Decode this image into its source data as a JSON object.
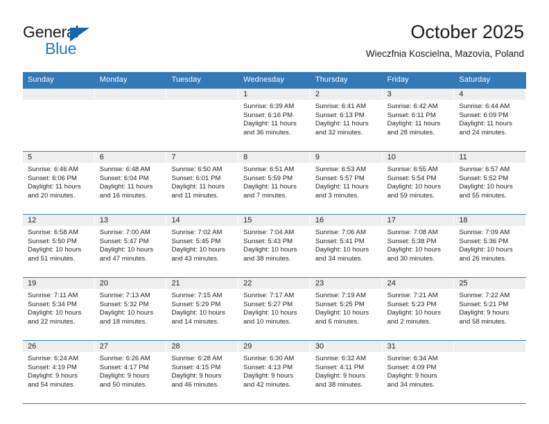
{
  "brand": {
    "name_part1": "General",
    "name_part2": "Blue",
    "logo_icon": "triangle-logo-icon",
    "blue": "#1f7ac4"
  },
  "header": {
    "title": "October 2025",
    "subtitle": "Wieczfnia Koscielna, Mazovia, Poland"
  },
  "calendar": {
    "header_color": "#3479b5",
    "weekdays": [
      "Sunday",
      "Monday",
      "Tuesday",
      "Wednesday",
      "Thursday",
      "Friday",
      "Saturday"
    ],
    "weeks": [
      [
        {
          "day": "",
          "sunrise": "",
          "sunset": "",
          "daylight1": "",
          "daylight2": ""
        },
        {
          "day": "",
          "sunrise": "",
          "sunset": "",
          "daylight1": "",
          "daylight2": ""
        },
        {
          "day": "",
          "sunrise": "",
          "sunset": "",
          "daylight1": "",
          "daylight2": ""
        },
        {
          "day": "1",
          "sunrise": "Sunrise: 6:39 AM",
          "sunset": "Sunset: 6:16 PM",
          "daylight1": "Daylight: 11 hours",
          "daylight2": "and 36 minutes."
        },
        {
          "day": "2",
          "sunrise": "Sunrise: 6:41 AM",
          "sunset": "Sunset: 6:13 PM",
          "daylight1": "Daylight: 11 hours",
          "daylight2": "and 32 minutes."
        },
        {
          "day": "3",
          "sunrise": "Sunrise: 6:42 AM",
          "sunset": "Sunset: 6:11 PM",
          "daylight1": "Daylight: 11 hours",
          "daylight2": "and 28 minutes."
        },
        {
          "day": "4",
          "sunrise": "Sunrise: 6:44 AM",
          "sunset": "Sunset: 6:09 PM",
          "daylight1": "Daylight: 11 hours",
          "daylight2": "and 24 minutes."
        }
      ],
      [
        {
          "day": "5",
          "sunrise": "Sunrise: 6:46 AM",
          "sunset": "Sunset: 6:06 PM",
          "daylight1": "Daylight: 11 hours",
          "daylight2": "and 20 minutes."
        },
        {
          "day": "6",
          "sunrise": "Sunrise: 6:48 AM",
          "sunset": "Sunset: 6:04 PM",
          "daylight1": "Daylight: 11 hours",
          "daylight2": "and 16 minutes."
        },
        {
          "day": "7",
          "sunrise": "Sunrise: 6:50 AM",
          "sunset": "Sunset: 6:01 PM",
          "daylight1": "Daylight: 11 hours",
          "daylight2": "and 11 minutes."
        },
        {
          "day": "8",
          "sunrise": "Sunrise: 6:51 AM",
          "sunset": "Sunset: 5:59 PM",
          "daylight1": "Daylight: 11 hours",
          "daylight2": "and 7 minutes."
        },
        {
          "day": "9",
          "sunrise": "Sunrise: 6:53 AM",
          "sunset": "Sunset: 5:57 PM",
          "daylight1": "Daylight: 11 hours",
          "daylight2": "and 3 minutes."
        },
        {
          "day": "10",
          "sunrise": "Sunrise: 6:55 AM",
          "sunset": "Sunset: 5:54 PM",
          "daylight1": "Daylight: 10 hours",
          "daylight2": "and 59 minutes."
        },
        {
          "day": "11",
          "sunrise": "Sunrise: 6:57 AM",
          "sunset": "Sunset: 5:52 PM",
          "daylight1": "Daylight: 10 hours",
          "daylight2": "and 55 minutes."
        }
      ],
      [
        {
          "day": "12",
          "sunrise": "Sunrise: 6:58 AM",
          "sunset": "Sunset: 5:50 PM",
          "daylight1": "Daylight: 10 hours",
          "daylight2": "and 51 minutes."
        },
        {
          "day": "13",
          "sunrise": "Sunrise: 7:00 AM",
          "sunset": "Sunset: 5:47 PM",
          "daylight1": "Daylight: 10 hours",
          "daylight2": "and 47 minutes."
        },
        {
          "day": "14",
          "sunrise": "Sunrise: 7:02 AM",
          "sunset": "Sunset: 5:45 PM",
          "daylight1": "Daylight: 10 hours",
          "daylight2": "and 43 minutes."
        },
        {
          "day": "15",
          "sunrise": "Sunrise: 7:04 AM",
          "sunset": "Sunset: 5:43 PM",
          "daylight1": "Daylight: 10 hours",
          "daylight2": "and 38 minutes."
        },
        {
          "day": "16",
          "sunrise": "Sunrise: 7:06 AM",
          "sunset": "Sunset: 5:41 PM",
          "daylight1": "Daylight: 10 hours",
          "daylight2": "and 34 minutes."
        },
        {
          "day": "17",
          "sunrise": "Sunrise: 7:08 AM",
          "sunset": "Sunset: 5:38 PM",
          "daylight1": "Daylight: 10 hours",
          "daylight2": "and 30 minutes."
        },
        {
          "day": "18",
          "sunrise": "Sunrise: 7:09 AM",
          "sunset": "Sunset: 5:36 PM",
          "daylight1": "Daylight: 10 hours",
          "daylight2": "and 26 minutes."
        }
      ],
      [
        {
          "day": "19",
          "sunrise": "Sunrise: 7:11 AM",
          "sunset": "Sunset: 5:34 PM",
          "daylight1": "Daylight: 10 hours",
          "daylight2": "and 22 minutes."
        },
        {
          "day": "20",
          "sunrise": "Sunrise: 7:13 AM",
          "sunset": "Sunset: 5:32 PM",
          "daylight1": "Daylight: 10 hours",
          "daylight2": "and 18 minutes."
        },
        {
          "day": "21",
          "sunrise": "Sunrise: 7:15 AM",
          "sunset": "Sunset: 5:29 PM",
          "daylight1": "Daylight: 10 hours",
          "daylight2": "and 14 minutes."
        },
        {
          "day": "22",
          "sunrise": "Sunrise: 7:17 AM",
          "sunset": "Sunset: 5:27 PM",
          "daylight1": "Daylight: 10 hours",
          "daylight2": "and 10 minutes."
        },
        {
          "day": "23",
          "sunrise": "Sunrise: 7:19 AM",
          "sunset": "Sunset: 5:25 PM",
          "daylight1": "Daylight: 10 hours",
          "daylight2": "and 6 minutes."
        },
        {
          "day": "24",
          "sunrise": "Sunrise: 7:21 AM",
          "sunset": "Sunset: 5:23 PM",
          "daylight1": "Daylight: 10 hours",
          "daylight2": "and 2 minutes."
        },
        {
          "day": "25",
          "sunrise": "Sunrise: 7:22 AM",
          "sunset": "Sunset: 5:21 PM",
          "daylight1": "Daylight: 9 hours",
          "daylight2": "and 58 minutes."
        }
      ],
      [
        {
          "day": "26",
          "sunrise": "Sunrise: 6:24 AM",
          "sunset": "Sunset: 4:19 PM",
          "daylight1": "Daylight: 9 hours",
          "daylight2": "and 54 minutes."
        },
        {
          "day": "27",
          "sunrise": "Sunrise: 6:26 AM",
          "sunset": "Sunset: 4:17 PM",
          "daylight1": "Daylight: 9 hours",
          "daylight2": "and 50 minutes."
        },
        {
          "day": "28",
          "sunrise": "Sunrise: 6:28 AM",
          "sunset": "Sunset: 4:15 PM",
          "daylight1": "Daylight: 9 hours",
          "daylight2": "and 46 minutes."
        },
        {
          "day": "29",
          "sunrise": "Sunrise: 6:30 AM",
          "sunset": "Sunset: 4:13 PM",
          "daylight1": "Daylight: 9 hours",
          "daylight2": "and 42 minutes."
        },
        {
          "day": "30",
          "sunrise": "Sunrise: 6:32 AM",
          "sunset": "Sunset: 4:11 PM",
          "daylight1": "Daylight: 9 hours",
          "daylight2": "and 38 minutes."
        },
        {
          "day": "31",
          "sunrise": "Sunrise: 6:34 AM",
          "sunset": "Sunset: 4:09 PM",
          "daylight1": "Daylight: 9 hours",
          "daylight2": "and 34 minutes."
        },
        {
          "day": "",
          "sunrise": "",
          "sunset": "",
          "daylight1": "",
          "daylight2": ""
        }
      ]
    ]
  }
}
